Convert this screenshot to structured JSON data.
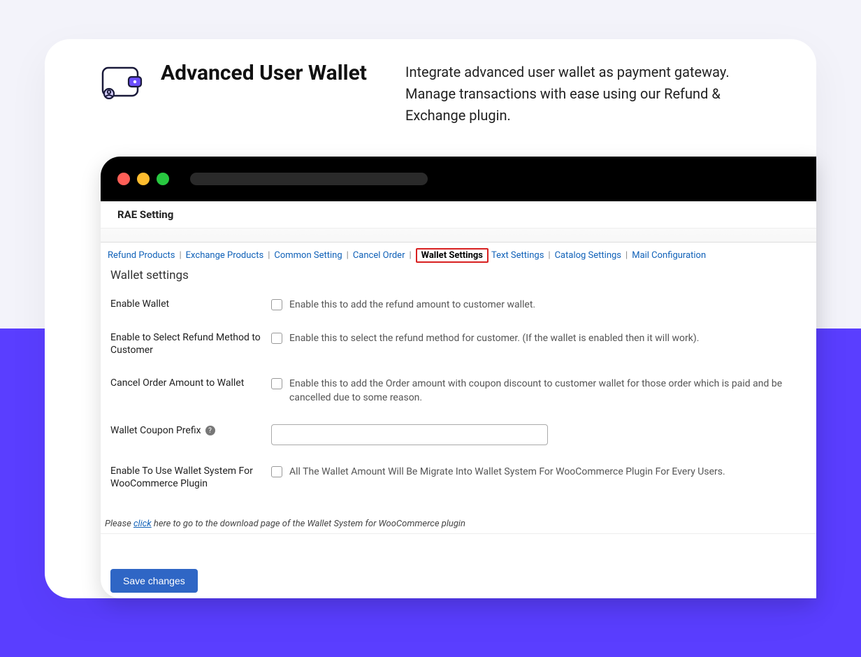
{
  "header": {
    "title": "Advanced User Wallet",
    "description": "Integrate advanced user wallet as payment gateway. Manage transactions with ease using our Refund & Exchange plugin."
  },
  "app": {
    "page_title": "RAE Setting",
    "tabs": {
      "refund_products": "Refund Products",
      "exchange_products": "Exchange Products",
      "common_setting": "Common Setting",
      "cancel_order": "Cancel Order",
      "wallet_settings": "Wallet Settings",
      "text_settings": "Text Settings",
      "catalog_settings": "Catalog Settings",
      "mail_configuration": "Mail Configuration"
    },
    "section_title": "Wallet settings",
    "fields": {
      "enable_wallet": {
        "label": "Enable Wallet",
        "hint": "Enable this to add the refund amount to customer wallet."
      },
      "enable_refund_method": {
        "label": "Enable to Select Refund Method to Customer",
        "hint": "Enable this to select the refund method for customer. (If the wallet is enabled then it will work)."
      },
      "cancel_order_amount": {
        "label": "Cancel Order Amount to Wallet",
        "hint": "Enable this to add the Order amount with coupon discount to customer wallet for those order which is paid and be cancelled due to some reason."
      },
      "coupon_prefix": {
        "label": "Wallet Coupon Prefix",
        "value": ""
      },
      "use_wallet_system": {
        "label": "Enable To Use Wallet System For WooCommerce Plugin",
        "hint": "All The Wallet Amount Will Be Migrate Into Wallet System For WooCommerce Plugin For Every Users."
      }
    },
    "note": {
      "prefix": "Please ",
      "link": "click",
      "suffix": " here to go to the download page of the Wallet System for WooCommerce plugin"
    },
    "save_label": "Save changes"
  }
}
